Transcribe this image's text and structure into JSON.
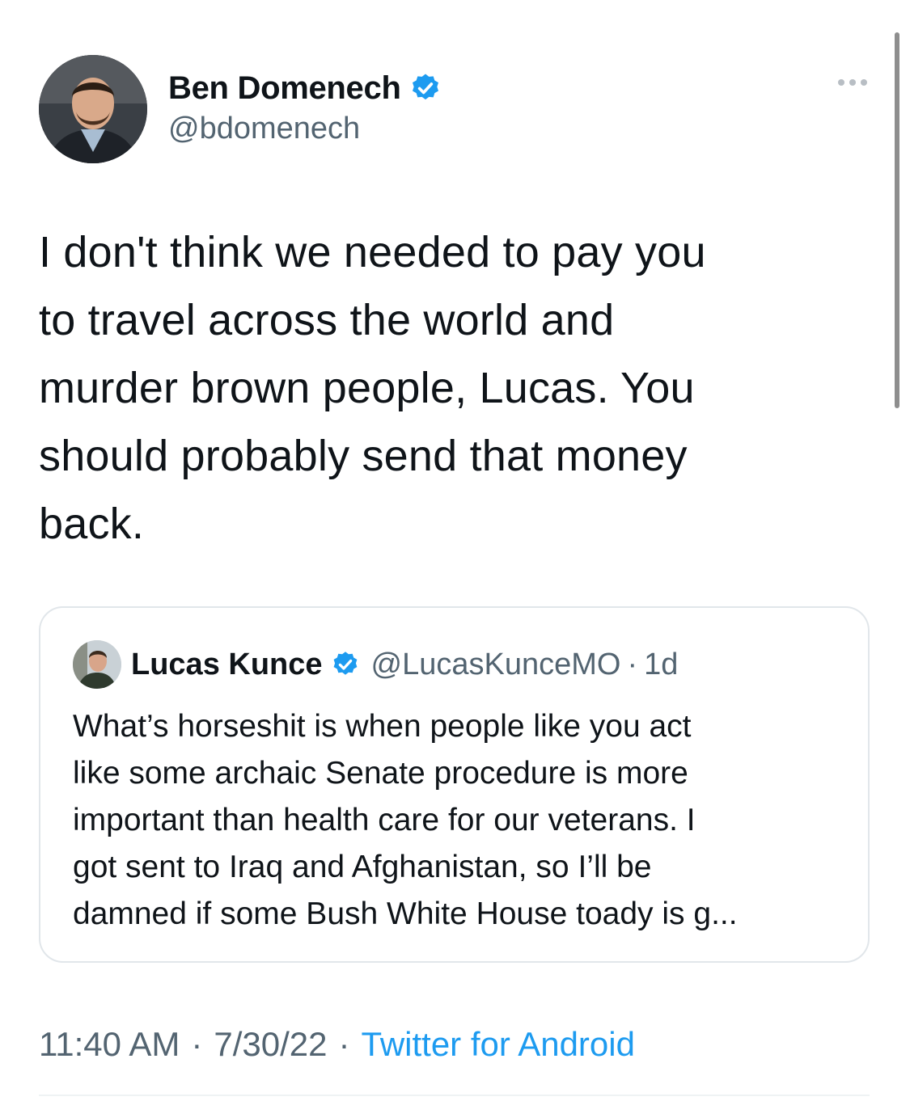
{
  "tweet": {
    "author": {
      "display_name": "Ben Domenech",
      "handle": "@bdomenech",
      "verified": true
    },
    "text": "I don't think we needed to pay you\nto travel across the world and\nmurder brown people, Lucas. You\nshould probably send that money\nback.",
    "quoted": {
      "display_name": "Lucas Kunce",
      "handle": "@LucasKunceMO",
      "dot": "·",
      "time": "1d",
      "text": "What’s horseshit is when people like you act\nlike some archaic Senate procedure is more\nimportant than health care for our veterans. I\ngot sent to Iraq and Afghanistan, so I’ll be\ndamned if some Bush White House toady is g..."
    },
    "footer": {
      "time": "11:40 AM",
      "date": "7/30/22",
      "separator": "·",
      "source": "Twitter for Android"
    }
  },
  "colors": {
    "accent": "#1d9bf0",
    "secondary_text": "#536471",
    "border": "#e1e6ea"
  },
  "icons": {
    "more": "more-horizontal-icon",
    "verified": "verified-badge-icon"
  }
}
